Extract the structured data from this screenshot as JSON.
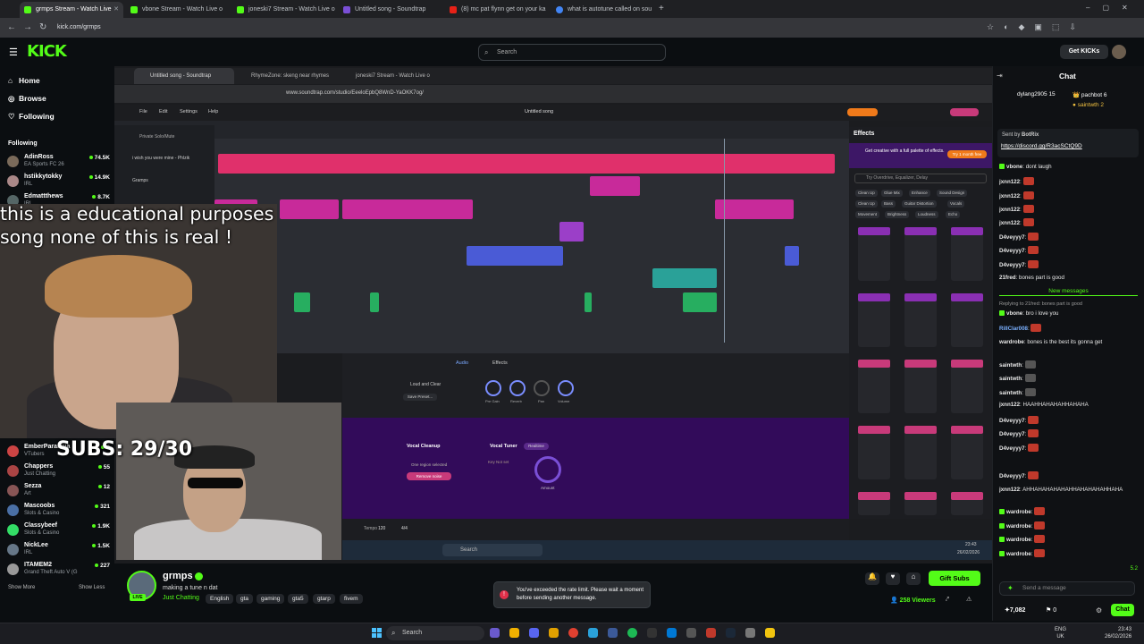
{
  "browser": {
    "tabs": [
      {
        "label": "grmps Stream - Watch Live",
        "active": true
      },
      {
        "label": "vbone Stream - Watch Live o"
      },
      {
        "label": "joneski7 Stream - Watch Live o"
      },
      {
        "label": "Untitled song - Soundtrap"
      },
      {
        "label": "(8) mc pat flynn get on your ka"
      },
      {
        "label": "what is autotune called on sou"
      }
    ],
    "url": "kick.com/grmps"
  },
  "kick": {
    "logo": "KICK",
    "search_placeholder": "Search",
    "get_kicks": "Get KICKs"
  },
  "sidebar": {
    "nav": [
      {
        "label": "Home"
      },
      {
        "label": "Browse"
      },
      {
        "label": "Following"
      }
    ],
    "following_title": "Following",
    "channels_top": [
      {
        "name": "AdinRoss",
        "category": "EA Sports FC 26",
        "viewers": "74.5K"
      },
      {
        "name": "hstikkytokky",
        "category": "IRL",
        "viewers": "14.9K"
      },
      {
        "name": "Edmattthews",
        "category": "IRL",
        "viewers": "8.7K"
      }
    ],
    "channels_bottom": [
      {
        "name": "EmberParanoia",
        "category": "VTubers",
        "viewers": "6"
      },
      {
        "name": "Chappers",
        "category": "Just Chatting",
        "viewers": "55"
      },
      {
        "name": "Sezza",
        "category": "Art",
        "viewers": "12"
      },
      {
        "name": "Mascoobs",
        "category": "Slots & Casino",
        "viewers": "321"
      },
      {
        "name": "Classybeef",
        "category": "Slots & Casino",
        "viewers": "1.9K"
      },
      {
        "name": "NickLee",
        "category": "IRL",
        "viewers": "1.5K"
      },
      {
        "name": "ITAMEM2",
        "category": "Grand Theft Auto V (G",
        "viewers": "227"
      }
    ],
    "show_more": "Show More",
    "show_less": "Show Less"
  },
  "stream": {
    "overlay_text_line1": "this is a educational purposes",
    "overlay_text_line2": "song none of this is real !",
    "subs_goal": "SUBS: 29/30",
    "inner_tabs": [
      "Untitled song - Soundtrap",
      "RhymeZone: skeng near rhymes",
      "joneski7 Stream - Watch Live o"
    ],
    "inner_url": "www.soundtrap.com/studio/EeeloEpbQ8WnD-YaOKK7og/",
    "daw_title": "Untitled song",
    "daw_menu": [
      "File",
      "Edit",
      "Settings",
      "Help"
    ],
    "tracks": [
      "Private Solo/Mute",
      "i wish you were mine - Phlzik",
      "Gramps"
    ],
    "effects_title": "Effects",
    "effects_promo": "Get creative with a full palette of effects.",
    "effects_trial": "Try 1 month free",
    "effects_search": "Try Overdrive, Equalizer, Delay",
    "effect_chips": [
      "Clean Up",
      "Glue Mix",
      "Enhance",
      "Sound Design",
      "Clean Up",
      "Bass",
      "Guitar Distortion",
      "Vocals",
      "Movement",
      "Brightness",
      "Loudness",
      "Echo"
    ],
    "audio_tab": "Audio",
    "effects_tab": "Effects",
    "preset": "Loud and Clear",
    "save_preset": "Save Preset...",
    "knobs": [
      "Pre Gain",
      "Reverb",
      "Pan",
      "Volume"
    ],
    "vocal_cleanup": "Vocal Cleanup",
    "one_region": "One region selected",
    "remove_noise": "Remove noise",
    "vocal_tuner": "Vocal Tuner",
    "realtime": "Realtime",
    "key_not_set": "Key Not set",
    "amount": "Amount",
    "tempo_label": "Tempo",
    "tempo": "120",
    "time_sig": "4/4",
    "win_search": "Search",
    "clock": "23:43",
    "date": "26/02/2026"
  },
  "streamer": {
    "name": "grmps",
    "title": "making a tune n dat",
    "category": "Just Chatting",
    "tags": [
      "English",
      "gta",
      "gaming",
      "gta5",
      "gtarp",
      "fivem"
    ],
    "viewers": "258 Viewers",
    "gift_subs": "Gift Subs"
  },
  "toast": {
    "message": "You've exceeded the rate limit. Please wait a moment before sending another message."
  },
  "chat": {
    "title": "Chat",
    "pinned": [
      {
        "user": "dylang2905",
        "count": "15"
      },
      {
        "user": "pachbot",
        "count": "6"
      },
      {
        "user": "saintwth",
        "count": "2"
      }
    ],
    "bot_sent_by": "Sent by",
    "bot_name": "BotRix",
    "bot_link": "https://discord.gg/R3acSCtQ9D",
    "messages": [
      {
        "user": "vbone",
        "text": "dont laugh"
      },
      {
        "user": "jxnn122",
        "text": ""
      },
      {
        "user": "jxnn122",
        "text": ""
      },
      {
        "user": "jxnn122",
        "text": ""
      },
      {
        "user": "jxnn122",
        "text": ""
      },
      {
        "user": "D4veyyy7",
        "text": ""
      },
      {
        "user": "D4veyyy7",
        "text": ""
      },
      {
        "user": "D4veyyy7",
        "text": ""
      },
      {
        "user": "21fred",
        "text": "bones part is good"
      }
    ],
    "new_messages": "New messages",
    "reply_note": "Replying to 21fred: bones part is good",
    "messages2": [
      {
        "user": "vbone",
        "text": "bro i love you"
      },
      {
        "user": "RillClar008",
        "text": ""
      },
      {
        "user": "wardrobe",
        "text": "bones is the best its gonna get"
      },
      {
        "user": "saintwth",
        "text": ""
      },
      {
        "user": "saintwth",
        "text": ""
      },
      {
        "user": "saintwth",
        "text": ""
      },
      {
        "user": "jxnn122",
        "text": "HAAHHAHAHAHHAHAHA"
      },
      {
        "user": "D4veyyy7",
        "text": ""
      },
      {
        "user": "D4veyyy7",
        "text": ""
      },
      {
        "user": "D4veyyy7",
        "text": ""
      },
      {
        "user": "D4veyyy7",
        "text": ""
      },
      {
        "user": "jxnn122",
        "text": "AHHAHAHAHAHAHHAHAHAHAHHAHA"
      },
      {
        "user": "wardrobe",
        "text": ""
      },
      {
        "user": "wardrobe",
        "text": ""
      },
      {
        "user": "wardrobe",
        "text": ""
      },
      {
        "user": "wardrobe",
        "text": ""
      }
    ],
    "input_placeholder": "Send a message",
    "kicks_balance": "7,082",
    "points": "0",
    "send": "Chat",
    "stat_reward": "5.2"
  },
  "taskbar": {
    "search": "Search",
    "lang1": "ENG",
    "lang2": "UK",
    "time": "23:43",
    "date": "26/02/2026"
  },
  "colors": {
    "kick_green": "#53fc18",
    "bg": "#0b0e11",
    "daw_pink": "#e0306b",
    "daw_magenta": "#c82a9a",
    "daw_blue": "#4a5bd6",
    "daw_teal": "#2aa198",
    "daw_green": "#27ae60",
    "purple_panel": "#320b5a"
  }
}
